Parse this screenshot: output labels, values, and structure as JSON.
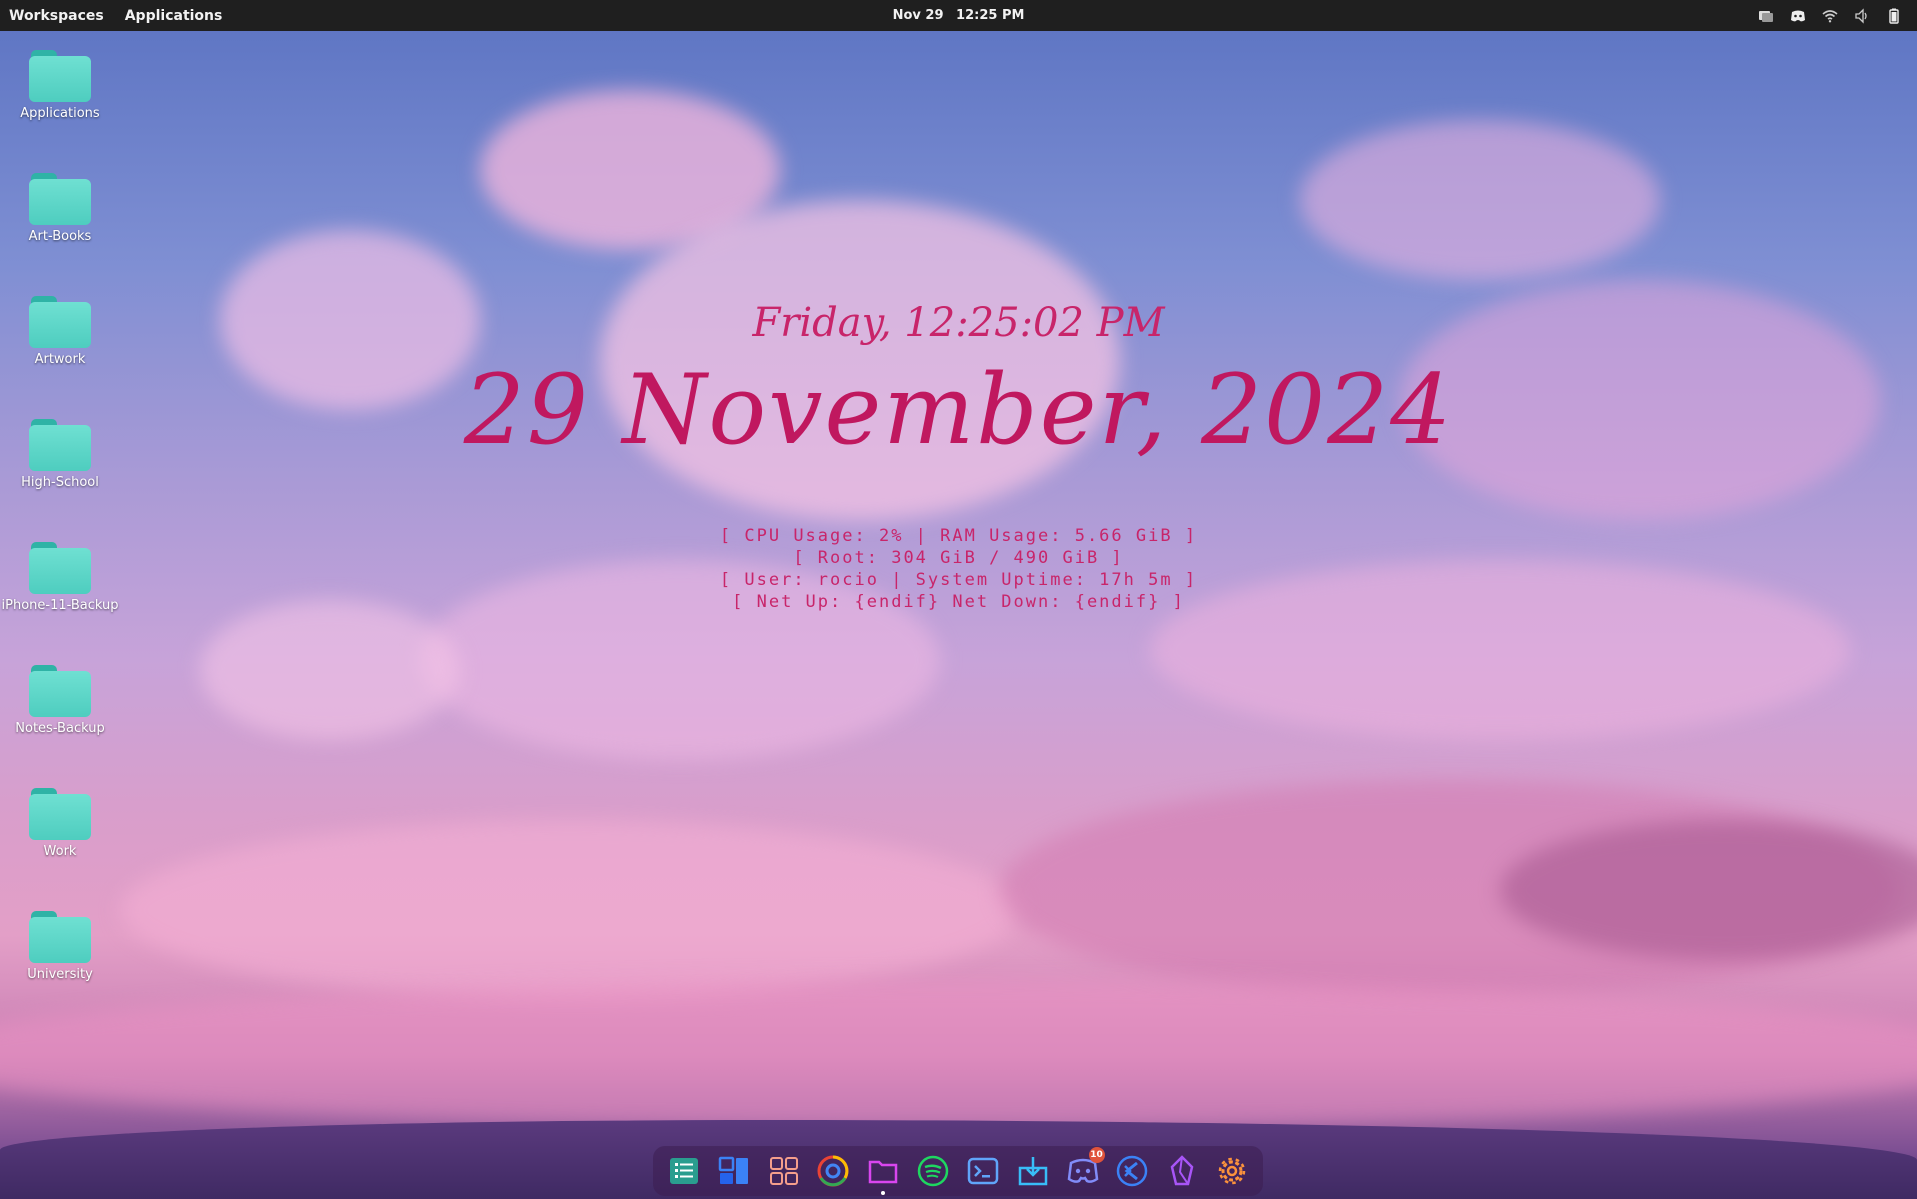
{
  "topbar": {
    "workspaces_label": "Workspaces",
    "applications_label": "Applications",
    "clock_date": "Nov 29",
    "clock_time": "12:25 PM",
    "tray": [
      "window-switcher-icon",
      "discord-icon",
      "wifi-icon",
      "volume-icon",
      "battery-icon"
    ]
  },
  "desktop_icons": [
    {
      "label": "Applications",
      "icon": "folder-icon"
    },
    {
      "label": "Art-Books",
      "icon": "folder-icon"
    },
    {
      "label": "Artwork",
      "icon": "folder-icon"
    },
    {
      "label": "High-School",
      "icon": "folder-icon"
    },
    {
      "label": "iPhone-11-Backup",
      "icon": "folder-icon"
    },
    {
      "label": "Notes-Backup",
      "icon": "folder-icon"
    },
    {
      "label": "Work",
      "icon": "folder-icon"
    },
    {
      "label": "University",
      "icon": "folder-icon"
    }
  ],
  "conky": {
    "day_time": "Friday, 12:25:02 PM",
    "date": "29 November, 2024",
    "stats": [
      "[ CPU Usage: 2% | RAM Usage: 5.66 GiB ]",
      "[ Root: 304 GiB / 490 GiB ]",
      "[ User: rocio | System Uptime: 17h 5m ]",
      "[ Net Up: {endif} Net Down: {endif} ]"
    ]
  },
  "dock": {
    "items": [
      "app-list-icon",
      "workspaces-icon",
      "app-grid-icon",
      "chrome-icon",
      "files-icon",
      "spotify-icon",
      "terminal-icon",
      "software-store-icon",
      "discord-icon",
      "vscode-icon",
      "obsidian-icon",
      "settings-icon"
    ],
    "discord_badge": "10"
  },
  "colors": {
    "accent_text": "#c0185f",
    "folder": "#4ecdbf",
    "topbar": "#1f1f1f"
  }
}
